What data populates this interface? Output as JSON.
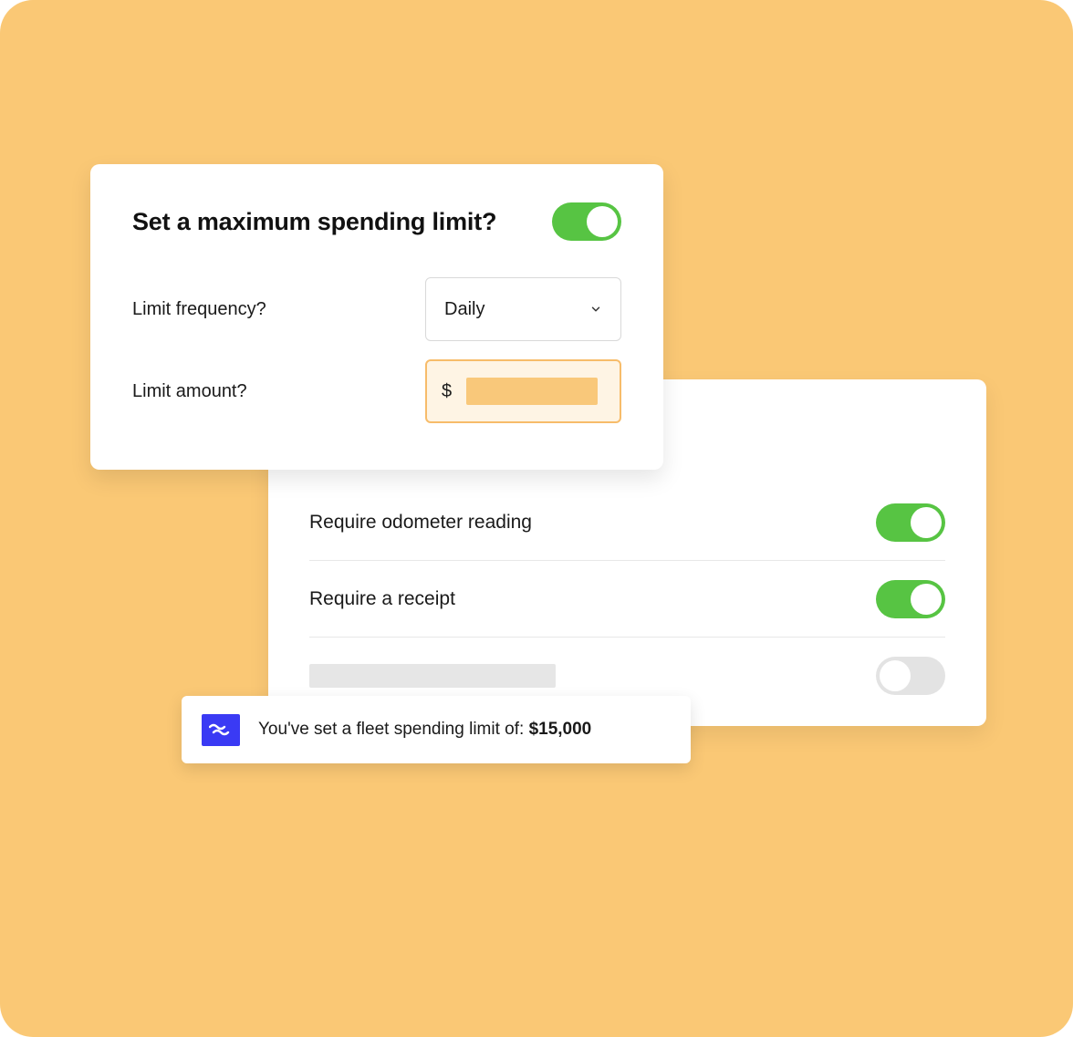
{
  "spending_card": {
    "title": "Set a maximum spending limit?",
    "toggle_on": true,
    "frequency_label": "Limit frequency?",
    "frequency_value": "Daily",
    "amount_label": "Limit amount?",
    "currency_symbol": "$"
  },
  "requirements_card": {
    "rows": [
      {
        "label": "Require odometer reading",
        "on": true
      },
      {
        "label": "Require a receipt",
        "on": true
      },
      {
        "label": "",
        "on": false
      }
    ]
  },
  "toast": {
    "message_prefix": "You've set a fleet spending limit of: ",
    "amount": "$15,000"
  },
  "colors": {
    "background": "#fac875",
    "toggle_on": "#57c443",
    "toggle_off": "#e3e3e3",
    "brand": "#3a3af4",
    "highlight_border": "#f7bc6a",
    "highlight_fill": "#fef4e4"
  }
}
